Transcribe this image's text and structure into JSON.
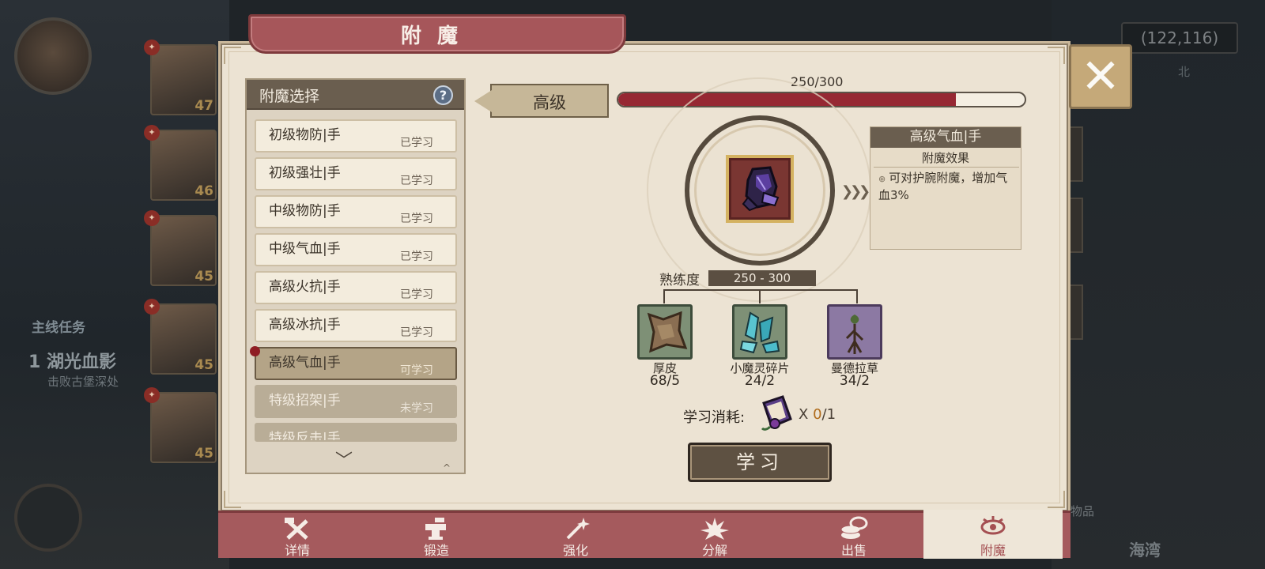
{
  "background": {
    "coords": "(122,116)",
    "north_label": "北",
    "task_header": "主线任务",
    "task_title": "1  湖光血影",
    "task_sub": "击败古堡深处",
    "location": "海湾",
    "items_label": "物品",
    "characters": [
      {
        "level": "47"
      },
      {
        "level": "46"
      },
      {
        "level": "45"
      },
      {
        "level": "45"
      },
      {
        "level": "45"
      }
    ]
  },
  "panel": {
    "title": "附魔"
  },
  "list": {
    "header": "附魔选择",
    "help_glyph": "?",
    "scroll_glyph": "﹀",
    "items": [
      {
        "name": "初级物防|手",
        "status": "已学习"
      },
      {
        "name": "初级强壮|手",
        "status": "已学习"
      },
      {
        "name": "中级物防|手",
        "status": "已学习"
      },
      {
        "name": "中级气血|手",
        "status": "已学习"
      },
      {
        "name": "高级火抗|手",
        "status": "已学习"
      },
      {
        "name": "高级冰抗|手",
        "status": "已学习"
      },
      {
        "name": "高级气血|手",
        "status": "可学习"
      },
      {
        "name": "特级招架|手",
        "status": "未学习"
      },
      {
        "name": "特级反击|手",
        "status": ""
      }
    ]
  },
  "level": {
    "label": "高级",
    "exp_text": "250/300",
    "exp_fraction": 0.83
  },
  "effect": {
    "title": "高级气血|手",
    "subtitle": "附魔效果",
    "bullet": "⊕",
    "description": "可对护腕附魔，增加气血3%"
  },
  "proficiency": {
    "label": "熟练度",
    "range": "250 - 300"
  },
  "materials": [
    {
      "name": "厚皮",
      "count": "68/5",
      "icon": "leather-icon"
    },
    {
      "name": "小魔灵碎片",
      "count": "24/2",
      "icon": "crystal-shard-icon"
    },
    {
      "name": "曼德拉草",
      "count": "34/2",
      "icon": "mandrake-icon"
    }
  ],
  "cost": {
    "label": "学习消耗:",
    "x": "X",
    "have": "0",
    "need": "/1"
  },
  "learn_button": "学习",
  "arrows": "❯❯❯",
  "close_glyph": "✕",
  "tabs": [
    {
      "label": "详情",
      "icon": "hammer-cross-icon"
    },
    {
      "label": "锻造",
      "icon": "anvil-icon"
    },
    {
      "label": "强化",
      "icon": "wand-sparkle-icon"
    },
    {
      "label": "分解",
      "icon": "explode-icon"
    },
    {
      "label": "出售",
      "icon": "coins-icon"
    },
    {
      "label": "附魔",
      "icon": "eye-rune-icon"
    }
  ],
  "colors": {
    "accent_red": "#962833",
    "ribbon": "#a6565a",
    "panel_bg": "#ece3d3",
    "tab_bar": "#a55a5d"
  }
}
